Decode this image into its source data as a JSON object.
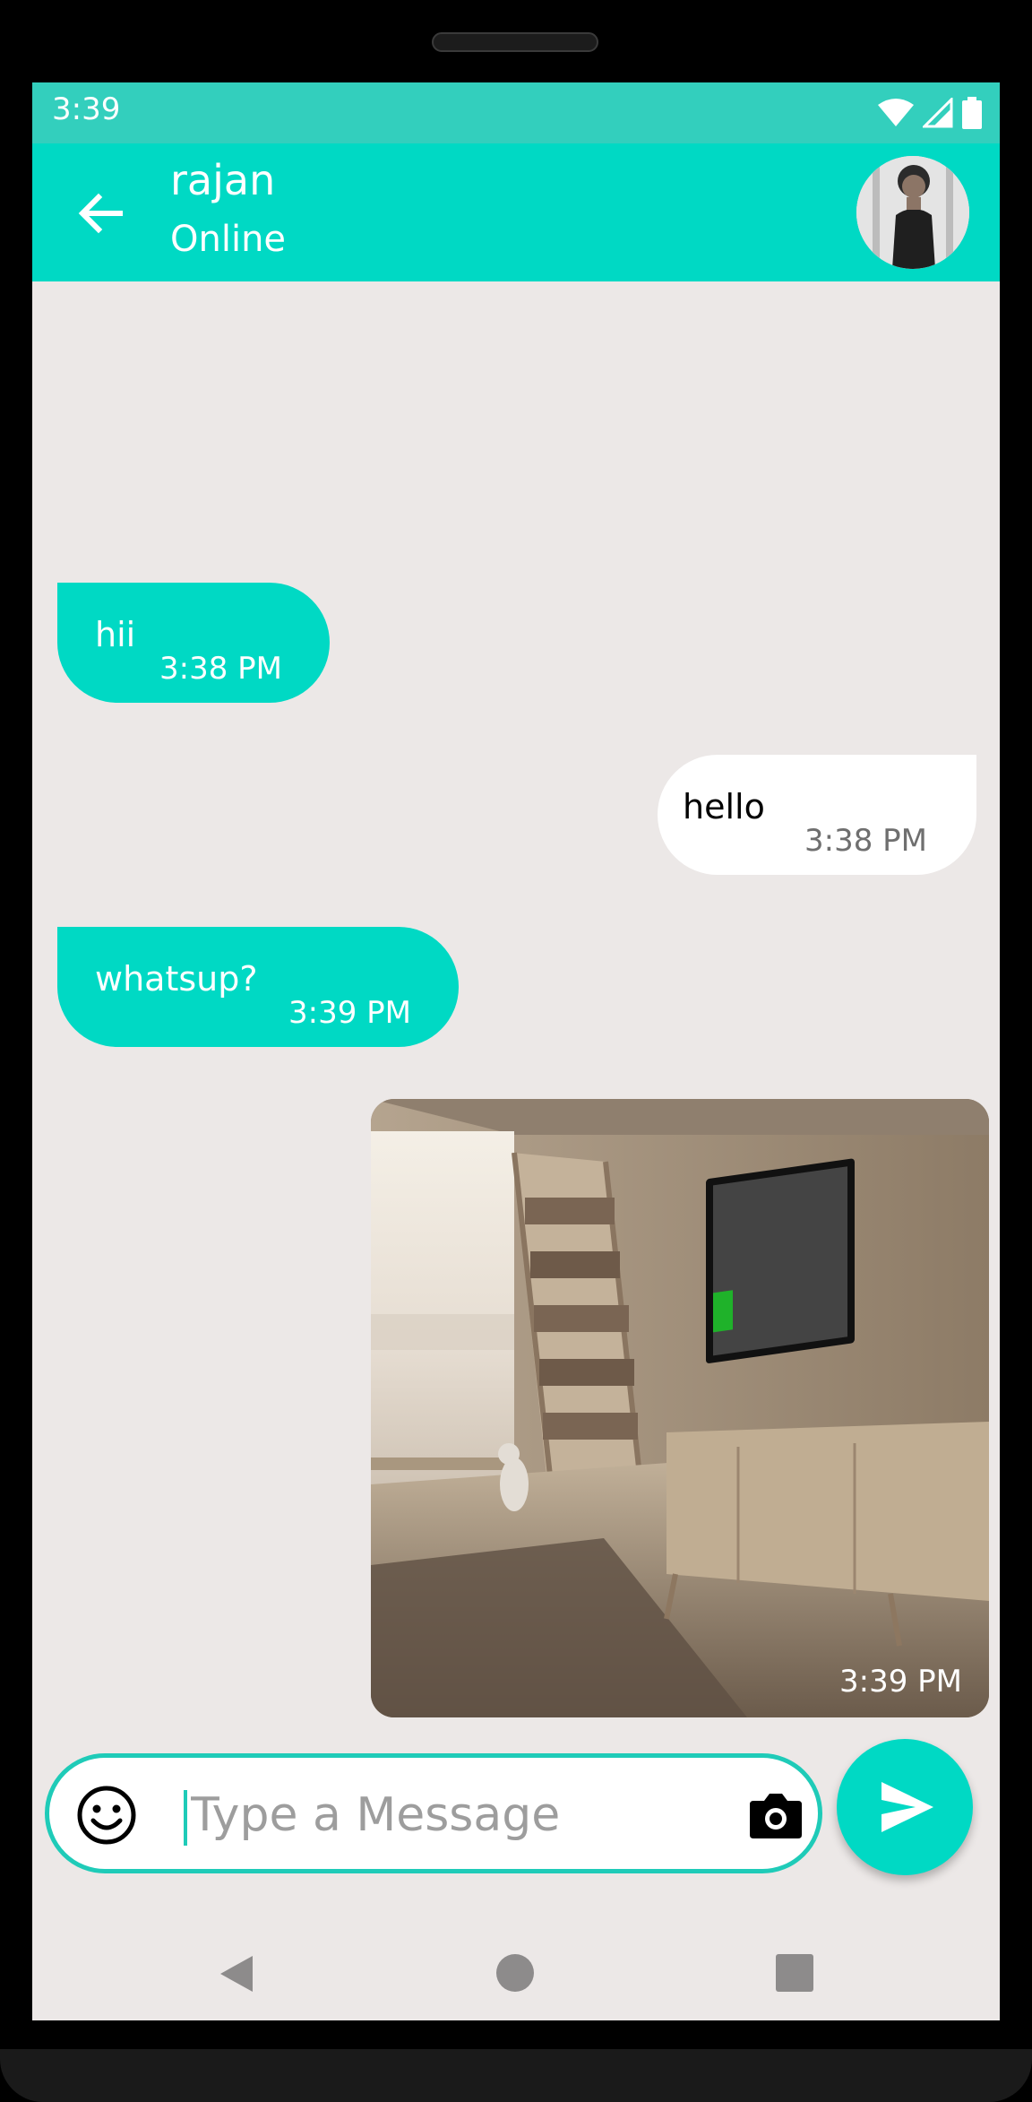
{
  "status_bar": {
    "time": "3:39"
  },
  "header": {
    "contact_name": "rajan",
    "contact_status": "Online"
  },
  "messages": [
    {
      "direction": "incoming",
      "text": "hii",
      "time": "3:38 PM"
    },
    {
      "direction": "outgoing",
      "text": "hello",
      "time": "3:38 PM"
    },
    {
      "direction": "incoming",
      "text": "whatsup?",
      "time": "3:39 PM"
    },
    {
      "direction": "outgoing",
      "type": "image",
      "time": "3:39 PM"
    }
  ],
  "composer": {
    "placeholder": "Type a Message",
    "value": ""
  },
  "icons": {
    "back": "arrow-left-icon",
    "emoji": "smiley-icon",
    "camera": "camera-icon",
    "send": "send-icon"
  },
  "colors": {
    "accent": "#00d9c4",
    "status_bar": "#33cfbd",
    "chat_background": "#ece8e7"
  }
}
